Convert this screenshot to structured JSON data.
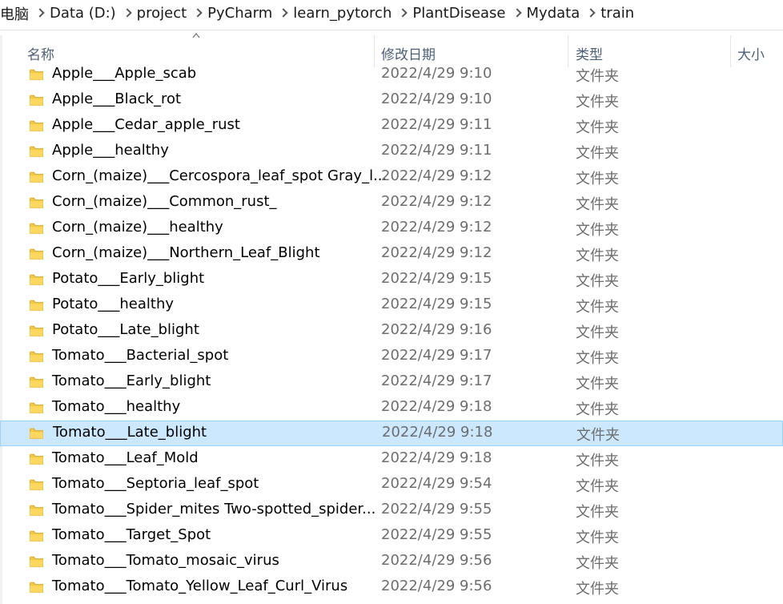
{
  "breadcrumb": [
    "电脑",
    "Data (D:)",
    "project",
    "PyCharm",
    "learn_pytorch",
    "PlantDisease",
    "Mydata",
    "train"
  ],
  "columns": {
    "name": "名称",
    "date": "修改日期",
    "type": "类型",
    "size": "大小"
  },
  "sort": {
    "column": "name",
    "direction": "ascending",
    "icon": "sort-up-icon"
  },
  "colors": {
    "folder": "#f5c542",
    "selected_bg": "#cce8ff",
    "selected_border": "#99d1ff",
    "header_text": "#4c607a"
  },
  "selected_index": 14,
  "rows": [
    {
      "name": "Apple___Apple_scab",
      "date": "2022/4/29 9:10",
      "type": "文件夹"
    },
    {
      "name": "Apple___Black_rot",
      "date": "2022/4/29 9:10",
      "type": "文件夹"
    },
    {
      "name": "Apple___Cedar_apple_rust",
      "date": "2022/4/29 9:11",
      "type": "文件夹"
    },
    {
      "name": "Apple___healthy",
      "date": "2022/4/29 9:11",
      "type": "文件夹"
    },
    {
      "name": "Corn_(maize)___Cercospora_leaf_spot Gray_l...",
      "date": "2022/4/29 9:12",
      "type": "文件夹"
    },
    {
      "name": "Corn_(maize)___Common_rust_",
      "date": "2022/4/29 9:12",
      "type": "文件夹"
    },
    {
      "name": "Corn_(maize)___healthy",
      "date": "2022/4/29 9:12",
      "type": "文件夹"
    },
    {
      "name": "Corn_(maize)___Northern_Leaf_Blight",
      "date": "2022/4/29 9:12",
      "type": "文件夹"
    },
    {
      "name": "Potato___Early_blight",
      "date": "2022/4/29 9:15",
      "type": "文件夹"
    },
    {
      "name": "Potato___healthy",
      "date": "2022/4/29 9:15",
      "type": "文件夹"
    },
    {
      "name": "Potato___Late_blight",
      "date": "2022/4/29 9:16",
      "type": "文件夹"
    },
    {
      "name": "Tomato___Bacterial_spot",
      "date": "2022/4/29 9:17",
      "type": "文件夹"
    },
    {
      "name": "Tomato___Early_blight",
      "date": "2022/4/29 9:17",
      "type": "文件夹"
    },
    {
      "name": "Tomato___healthy",
      "date": "2022/4/29 9:18",
      "type": "文件夹"
    },
    {
      "name": "Tomato___Late_blight",
      "date": "2022/4/29 9:18",
      "type": "文件夹"
    },
    {
      "name": "Tomato___Leaf_Mold",
      "date": "2022/4/29 9:18",
      "type": "文件夹"
    },
    {
      "name": "Tomato___Septoria_leaf_spot",
      "date": "2022/4/29 9:54",
      "type": "文件夹"
    },
    {
      "name": "Tomato___Spider_mites Two-spotted_spider...",
      "date": "2022/4/29 9:55",
      "type": "文件夹"
    },
    {
      "name": "Tomato___Target_Spot",
      "date": "2022/4/29 9:55",
      "type": "文件夹"
    },
    {
      "name": "Tomato___Tomato_mosaic_virus",
      "date": "2022/4/29 9:56",
      "type": "文件夹"
    },
    {
      "name": "Tomato___Tomato_Yellow_Leaf_Curl_Virus",
      "date": "2022/4/29 9:56",
      "type": "文件夹"
    }
  ]
}
